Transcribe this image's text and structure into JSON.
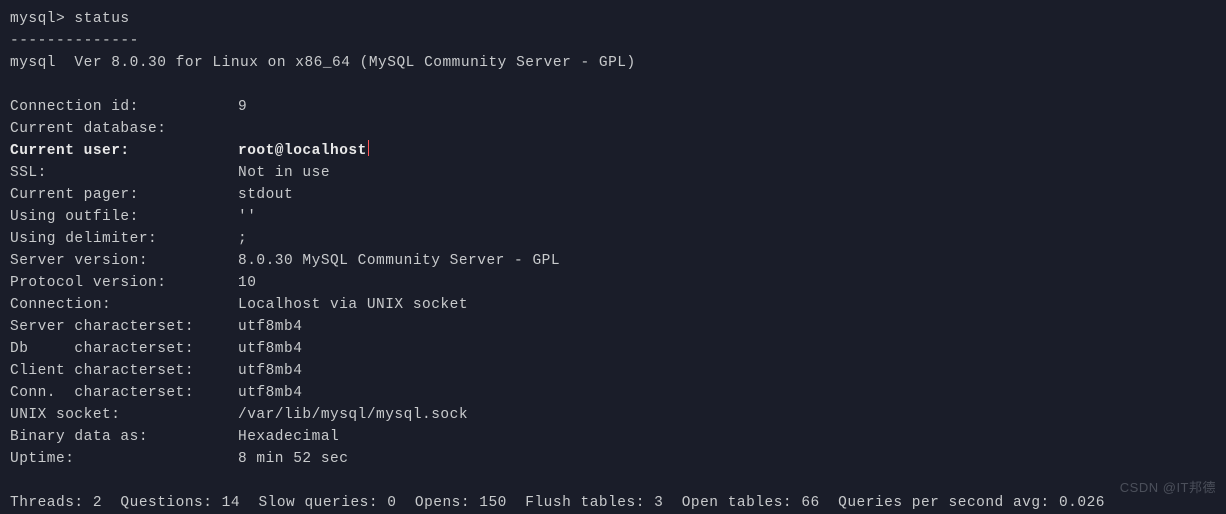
{
  "prompt": "mysql> ",
  "command": "status",
  "divider": "--------------",
  "version_line": "mysql  Ver 8.0.30 for Linux on x86_64 (MySQL Community Server - GPL)",
  "status_rows": [
    {
      "label": "Connection id:",
      "value": "9",
      "bold": false
    },
    {
      "label": "Current database:",
      "value": "",
      "bold": false
    },
    {
      "label": "Current user:",
      "value": "root@localhost",
      "bold": true,
      "cursor": true
    },
    {
      "label": "SSL:",
      "value": "Not in use",
      "bold": false
    },
    {
      "label": "Current pager:",
      "value": "stdout",
      "bold": false
    },
    {
      "label": "Using outfile:",
      "value": "''",
      "bold": false
    },
    {
      "label": "Using delimiter:",
      "value": ";",
      "bold": false
    },
    {
      "label": "Server version:",
      "value": "8.0.30 MySQL Community Server - GPL",
      "bold": false
    },
    {
      "label": "Protocol version:",
      "value": "10",
      "bold": false
    },
    {
      "label": "Connection:",
      "value": "Localhost via UNIX socket",
      "bold": false
    },
    {
      "label": "Server characterset:",
      "value": "utf8mb4",
      "bold": false
    },
    {
      "label": "Db     characterset:",
      "value": "utf8mb4",
      "bold": false
    },
    {
      "label": "Client characterset:",
      "value": "utf8mb4",
      "bold": false
    },
    {
      "label": "Conn.  characterset:",
      "value": "utf8mb4",
      "bold": false
    },
    {
      "label": "UNIX socket:",
      "value": "/var/lib/mysql/mysql.sock",
      "bold": false
    },
    {
      "label": "Binary data as:",
      "value": "Hexadecimal",
      "bold": false
    },
    {
      "label": "Uptime:",
      "value": "8 min 52 sec",
      "bold": false
    }
  ],
  "stats_line": "Threads: 2  Questions: 14  Slow queries: 0  Opens: 150  Flush tables: 3  Open tables: 66  Queries per second avg: 0.026",
  "watermark": "CSDN @IT邦德"
}
